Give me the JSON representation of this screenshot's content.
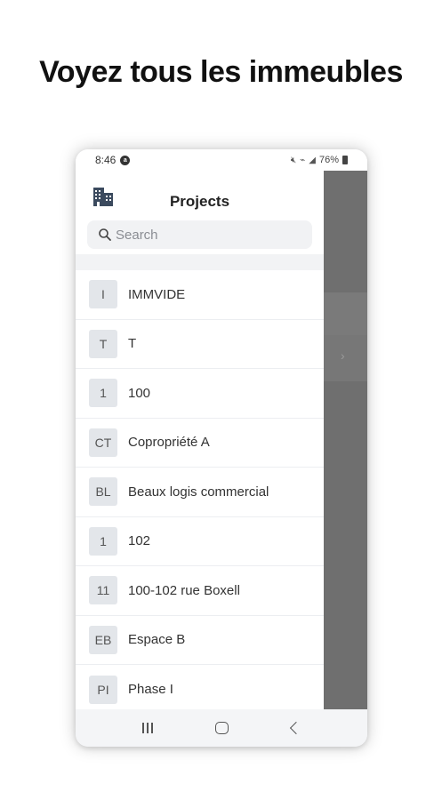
{
  "headline": "Voyez tous les immeubles",
  "status_bar": {
    "time": "8:46",
    "notification_glyph": "a",
    "battery_percent": "76%"
  },
  "drawer": {
    "title": "Projects",
    "search": {
      "placeholder": "Search",
      "value": ""
    }
  },
  "projects": [
    {
      "initials": "I",
      "name": "IMMVIDE"
    },
    {
      "initials": "T",
      "name": "T"
    },
    {
      "initials": "1",
      "name": "100"
    },
    {
      "initials": "CT",
      "name": "Copropriété A"
    },
    {
      "initials": "BL",
      "name": "Beaux logis commercial"
    },
    {
      "initials": "1",
      "name": "102"
    },
    {
      "initials": "11",
      "name": "100-102 rue Boxell"
    },
    {
      "initials": "EB",
      "name": "Espace B"
    },
    {
      "initials": "PI",
      "name": "Phase I"
    }
  ],
  "icons": {
    "drawer_logo": "building-icon",
    "search": "search-icon",
    "overlay_chevron": "chevron-right-icon",
    "nav": [
      "recents-icon",
      "home-icon",
      "back-icon"
    ]
  },
  "colors": {
    "overlay": "#6f6f6f",
    "avatar_bg": "#e3e6ea",
    "search_bg": "#f1f2f4"
  }
}
